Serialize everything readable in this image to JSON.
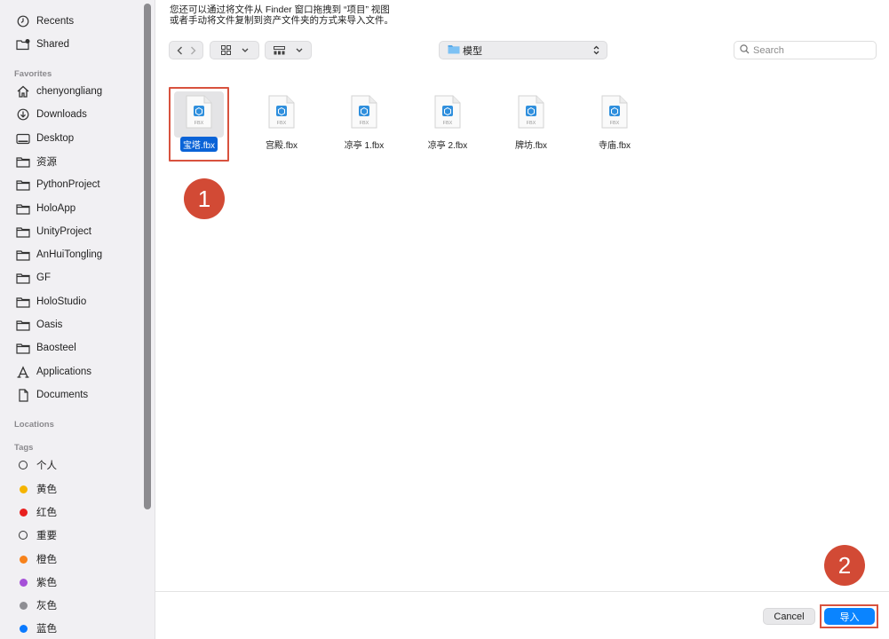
{
  "sidebar": {
    "top_items": [
      {
        "label": "Recents",
        "icon": "clock-icon"
      },
      {
        "label": "Shared",
        "icon": "shared-folder-icon"
      }
    ],
    "favorites_heading": "Favorites",
    "favorites": [
      {
        "label": "chenyongliang",
        "icon": "home-icon"
      },
      {
        "label": "Downloads",
        "icon": "download-icon"
      },
      {
        "label": "Desktop",
        "icon": "desktop-icon"
      },
      {
        "label": "资源",
        "icon": "folder-icon"
      },
      {
        "label": "PythonProject",
        "icon": "folder-icon"
      },
      {
        "label": "HoloApp",
        "icon": "folder-icon"
      },
      {
        "label": "UnityProject",
        "icon": "folder-icon"
      },
      {
        "label": "AnHuiTongling",
        "icon": "folder-icon"
      },
      {
        "label": "GF",
        "icon": "folder-icon"
      },
      {
        "label": "HoloStudio",
        "icon": "folder-icon"
      },
      {
        "label": "Oasis",
        "icon": "folder-icon"
      },
      {
        "label": "Baosteel",
        "icon": "folder-icon"
      },
      {
        "label": "Applications",
        "icon": "applications-icon"
      },
      {
        "label": "Documents",
        "icon": "document-icon"
      }
    ],
    "locations_heading": "Locations",
    "tags_heading": "Tags",
    "tags": [
      {
        "label": "个人",
        "color": "ring"
      },
      {
        "label": "黄色",
        "color": "#f5b400"
      },
      {
        "label": "红色",
        "color": "#e8201f"
      },
      {
        "label": "重要",
        "color": "ring"
      },
      {
        "label": "橙色",
        "color": "#f7821b"
      },
      {
        "label": "紫色",
        "color": "#a550d8"
      },
      {
        "label": "灰色",
        "color": "#8e8e93"
      },
      {
        "label": "蓝色",
        "color": "#0a7aff"
      }
    ]
  },
  "hint": {
    "line1": "您还可以通过将文件从 Finder 窗口拖拽到 “项目” 视图",
    "line2": "或者手动将文件复制到资产文件夹的方式来导入文件。"
  },
  "toolbar": {
    "current_folder": "模型",
    "search_placeholder": "Search"
  },
  "files": [
    {
      "name": "宝塔.fbx",
      "type_label": "FBX",
      "selected": true
    },
    {
      "name": "宫殿.fbx",
      "type_label": "FBX",
      "selected": false
    },
    {
      "name": "凉亭 1.fbx",
      "type_label": "FBX",
      "selected": false
    },
    {
      "name": "凉亭 2.fbx",
      "type_label": "FBX",
      "selected": false
    },
    {
      "name": "牌坊.fbx",
      "type_label": "FBX",
      "selected": false
    },
    {
      "name": "寺庙.fbx",
      "type_label": "FBX",
      "selected": false
    }
  ],
  "annotations": {
    "step1": "1",
    "step2": "2"
  },
  "buttons": {
    "cancel": "Cancel",
    "import": "导入"
  },
  "colors": {
    "accent": "#0a84ff",
    "selection": "#0a63d7",
    "annotation": "#d24a35"
  }
}
